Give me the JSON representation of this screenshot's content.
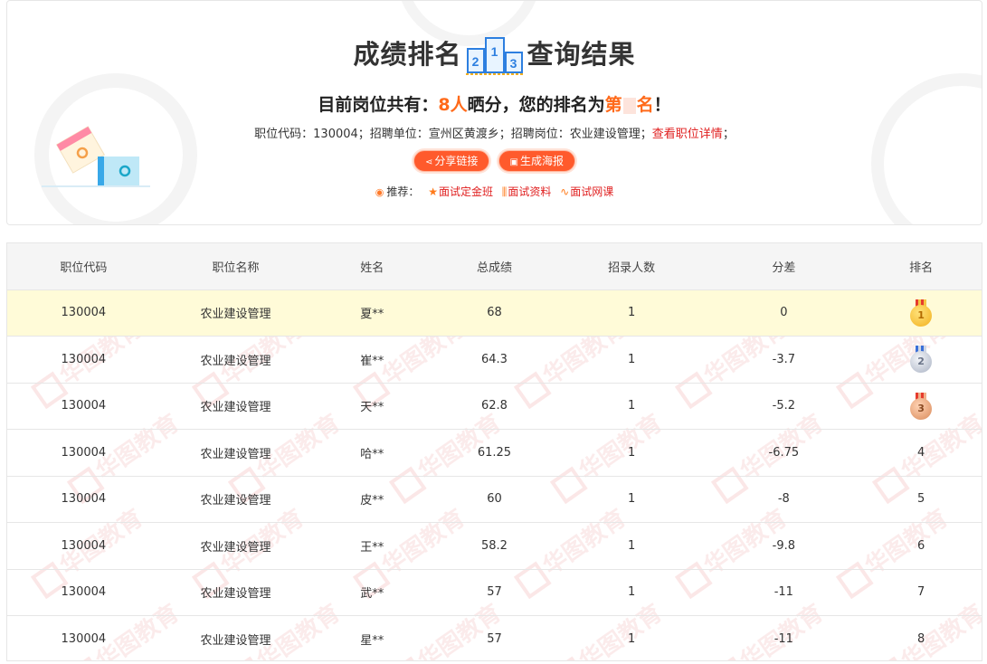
{
  "header": {
    "title_left": "成绩排名",
    "title_right": "查询结果",
    "subtitle_prefix": "目前岗位共有：",
    "subtitle_count": "8人",
    "subtitle_middle": "晒分，您的排名为",
    "subtitle_rank_prefix": "第",
    "subtitle_rank_suffix": "名",
    "subtitle_end": "！",
    "info_text": "职位代码：130004；招聘单位：宣州区黄渡乡；招聘岗位：农业建设管理；",
    "info_link": "查看职位详情",
    "info_end": "；",
    "share_button": "分享链接",
    "poster_button": "生成海报",
    "recommend_label": "推荐：",
    "recommend_items": [
      "面试定金班",
      "面试资料",
      "面试网课"
    ]
  },
  "table": {
    "columns": [
      "职位代码",
      "职位名称",
      "姓名",
      "总成绩",
      "招录人数",
      "分差",
      "排名"
    ],
    "rows": [
      {
        "code": "130004",
        "position": "农业建设管理",
        "name": "夏**",
        "score": "68",
        "quota": "1",
        "diff": "0",
        "rank": "1"
      },
      {
        "code": "130004",
        "position": "农业建设管理",
        "name": "崔**",
        "score": "64.3",
        "quota": "1",
        "diff": "-3.7",
        "rank": "2"
      },
      {
        "code": "130004",
        "position": "农业建设管理",
        "name": "天**",
        "score": "62.8",
        "quota": "1",
        "diff": "-5.2",
        "rank": "3"
      },
      {
        "code": "130004",
        "position": "农业建设管理",
        "name": "哈**",
        "score": "61.25",
        "quota": "1",
        "diff": "-6.75",
        "rank": "4"
      },
      {
        "code": "130004",
        "position": "农业建设管理",
        "name": "皮**",
        "score": "60",
        "quota": "1",
        "diff": "-8",
        "rank": "5"
      },
      {
        "code": "130004",
        "position": "农业建设管理",
        "name": "王**",
        "score": "58.2",
        "quota": "1",
        "diff": "-9.8",
        "rank": "6"
      },
      {
        "code": "130004",
        "position": "农业建设管理",
        "name": "武**",
        "score": "57",
        "quota": "1",
        "diff": "-11",
        "rank": "7"
      },
      {
        "code": "130004",
        "position": "农业建设管理",
        "name": "星**",
        "score": "57",
        "quota": "1",
        "diff": "-11",
        "rank": "8"
      }
    ]
  },
  "watermark": "华图教育",
  "colors": {
    "accent": "#ff5a2c",
    "highlight_row": "#fffbd8",
    "link_red": "#e02020"
  }
}
